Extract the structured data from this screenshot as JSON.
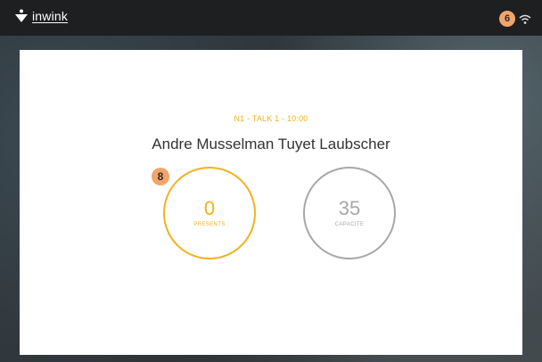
{
  "header": {
    "brand_name": "inwink",
    "badge_count": "6",
    "icons": {
      "brand": "inwink-logo-icon",
      "status": "wifi-icon"
    }
  },
  "session": {
    "title": "N1 - TALK 1 - 10:00",
    "speakers": "Andre Musselman Tuyet Laubscher"
  },
  "counters": {
    "presents": {
      "value": "0",
      "label": "PRESENTS"
    },
    "capacity": {
      "value": "35",
      "label": "CAPACITE"
    }
  },
  "markers": {
    "presents_marker": "8"
  },
  "colors": {
    "accent": "#f0b21e",
    "muted": "#a7a7a7",
    "badge": "#f2a56a",
    "topbar": "#1e1f21"
  }
}
